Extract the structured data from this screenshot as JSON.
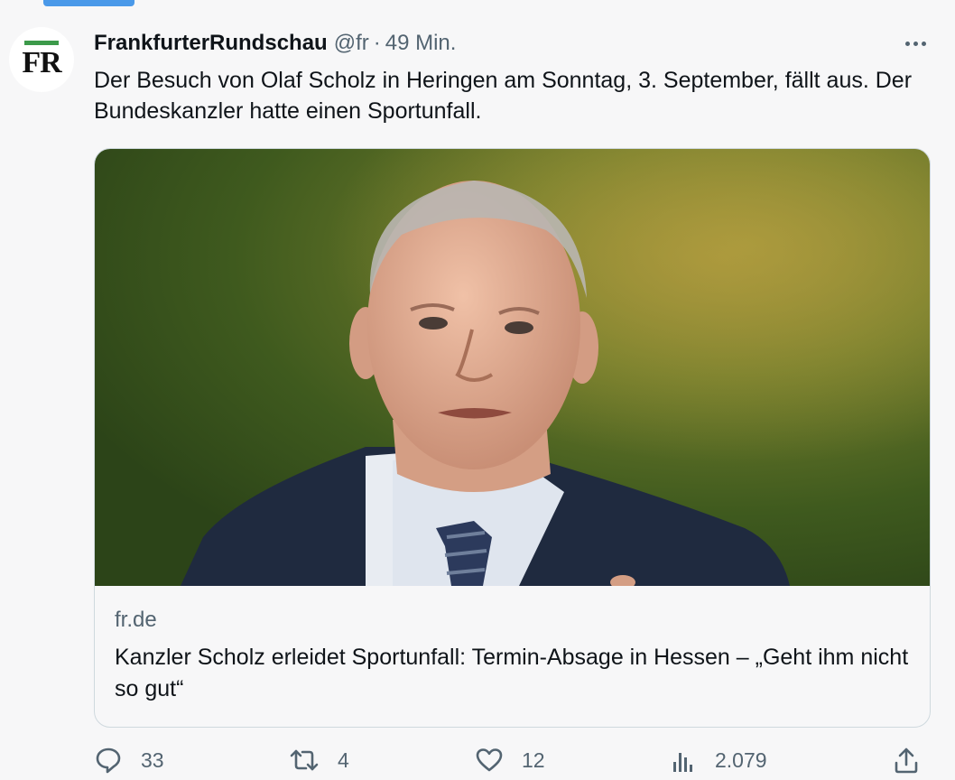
{
  "tweet": {
    "author_name": "FrankfurterRundschau",
    "handle": "@fr",
    "separator": "·",
    "time": "49 Min.",
    "text": "Der Besuch von Olaf Scholz in Heringen am Sonntag, 3. September, fällt aus. Der Bundeskanzler hatte einen Sportunfall."
  },
  "avatar": {
    "letters": "FR",
    "accent_color": "#3c9a4a"
  },
  "card": {
    "domain": "fr.de",
    "title": "Kanzler Scholz erleidet Sportunfall: Termin-Absage in Hessen – „Geht ihm nicht so gut“"
  },
  "actions": {
    "replies": "33",
    "retweets": "4",
    "likes": "12",
    "views": "2.079"
  },
  "colors": {
    "accent": "#4a99e9",
    "muted": "#536471",
    "text": "#0f1419"
  }
}
